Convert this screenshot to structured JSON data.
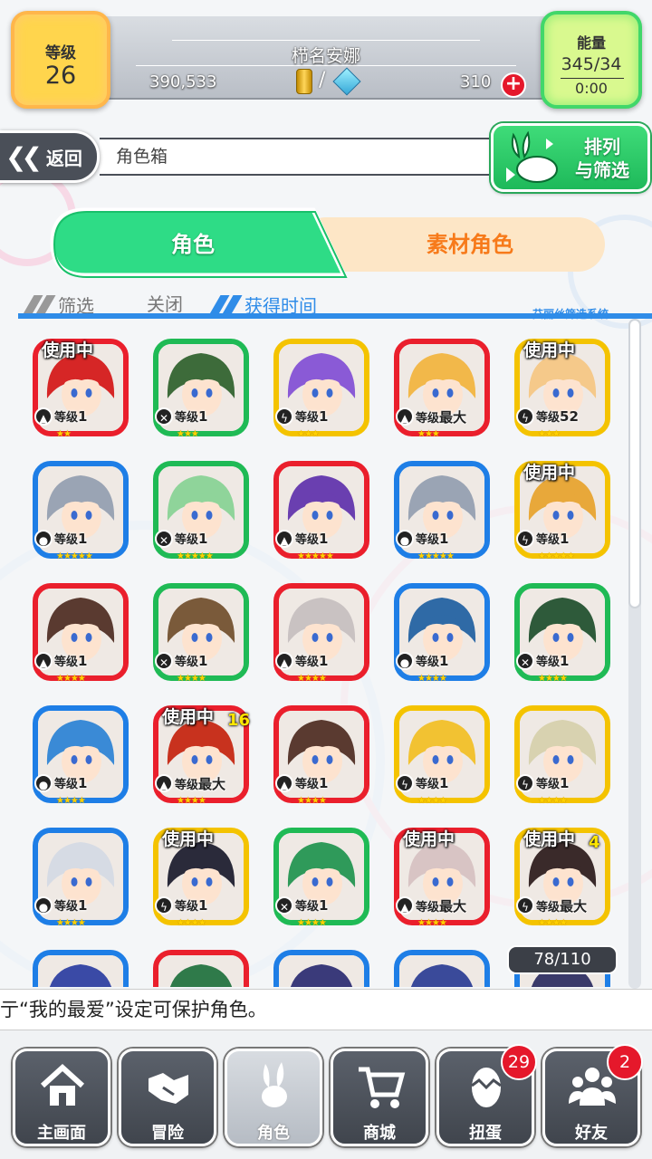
{
  "header": {
    "level_label": "等级",
    "level_value": "26",
    "player_name": "栉名安娜",
    "coins": "390,533",
    "slash": "/",
    "gems": "310",
    "energy_label": "能量",
    "energy_value": "345/34",
    "energy_timer": "0:00"
  },
  "nav": {
    "back_label": "返回",
    "breadcrumb": "角色箱",
    "sort_filter_line1": "排列",
    "sort_filter_line2": "与筛选"
  },
  "tabs": [
    {
      "label": "角色",
      "active": true
    },
    {
      "label": "素材角色",
      "active": false
    }
  ],
  "filter": {
    "filter_label": "筛选",
    "filter_state": "关闭",
    "sort_label": "获得时间",
    "system_label": "艾丽丝筛选系统"
  },
  "cards": [
    {
      "frame": "red",
      "element": "fire",
      "level": "1",
      "stars": 2,
      "in_use": "使用中",
      "badge": "",
      "hue": "#d62626"
    },
    {
      "frame": "green",
      "element": "wind",
      "level": "1",
      "stars": 3,
      "in_use": "",
      "badge": "",
      "hue": "#3d6b3a"
    },
    {
      "frame": "yellow",
      "element": "thunder",
      "level": "1",
      "stars": 3,
      "in_use": "",
      "badge": "",
      "hue": "#8a5ad6"
    },
    {
      "frame": "red",
      "element": "fire",
      "level": "最大",
      "stars": 3,
      "in_use": "",
      "badge": "",
      "hue": "#f2b84a"
    },
    {
      "frame": "yellow",
      "element": "thunder",
      "level": "52",
      "stars": 3,
      "in_use": "使用中",
      "badge": "",
      "hue": "#f5c98a"
    },
    {
      "frame": "blue",
      "element": "water",
      "level": "1",
      "stars": 5,
      "in_use": "",
      "badge": "",
      "hue": "#9aa4b4"
    },
    {
      "frame": "green",
      "element": "wind",
      "level": "1",
      "stars": 5,
      "in_use": "",
      "badge": "",
      "hue": "#8fd49a"
    },
    {
      "frame": "red",
      "element": "fire",
      "level": "1",
      "stars": 5,
      "in_use": "",
      "badge": "",
      "hue": "#6a3fb0"
    },
    {
      "frame": "blue",
      "element": "water",
      "level": "1",
      "stars": 5,
      "in_use": "",
      "badge": "",
      "hue": "#9aa4b4"
    },
    {
      "frame": "yellow",
      "element": "thunder",
      "level": "1",
      "stars": 5,
      "in_use": "使用中",
      "badge": "",
      "hue": "#e8a83a"
    },
    {
      "frame": "red",
      "element": "fire",
      "level": "1",
      "stars": 4,
      "in_use": "",
      "badge": "",
      "hue": "#5a3a30"
    },
    {
      "frame": "green",
      "element": "wind",
      "level": "1",
      "stars": 4,
      "in_use": "",
      "badge": "",
      "hue": "#7a5a3a"
    },
    {
      "frame": "red",
      "element": "fire",
      "level": "1",
      "stars": 4,
      "in_use": "",
      "badge": "",
      "hue": "#c9c2c2"
    },
    {
      "frame": "blue",
      "element": "water",
      "level": "1",
      "stars": 4,
      "in_use": "",
      "badge": "",
      "hue": "#2f6aa6"
    },
    {
      "frame": "green",
      "element": "wind",
      "level": "1",
      "stars": 4,
      "in_use": "",
      "badge": "",
      "hue": "#2e5a3a"
    },
    {
      "frame": "blue",
      "element": "water",
      "level": "1",
      "stars": 4,
      "in_use": "",
      "badge": "",
      "hue": "#3a8ad6"
    },
    {
      "frame": "red",
      "element": "fire",
      "level": "最大",
      "stars": 4,
      "in_use": "使用中",
      "badge": "16",
      "hue": "#c8321e"
    },
    {
      "frame": "red",
      "element": "fire",
      "level": "1",
      "stars": 4,
      "in_use": "",
      "badge": "",
      "hue": "#5a3a30"
    },
    {
      "frame": "yellow",
      "element": "thunder",
      "level": "1",
      "stars": 4,
      "in_use": "",
      "badge": "",
      "hue": "#f2c232"
    },
    {
      "frame": "yellow",
      "element": "thunder",
      "level": "1",
      "stars": 4,
      "in_use": "",
      "badge": "",
      "hue": "#d8d2b0"
    },
    {
      "frame": "blue",
      "element": "water",
      "level": "1",
      "stars": 4,
      "in_use": "",
      "badge": "",
      "hue": "#d6dbe4"
    },
    {
      "frame": "yellow",
      "element": "thunder",
      "level": "1",
      "stars": 4,
      "in_use": "使用中",
      "badge": "",
      "hue": "#2a2a3a"
    },
    {
      "frame": "green",
      "element": "wind",
      "level": "1",
      "stars": 4,
      "in_use": "",
      "badge": "",
      "hue": "#2f9a5a"
    },
    {
      "frame": "red",
      "element": "fire",
      "level": "最大",
      "stars": 4,
      "in_use": "使用中",
      "badge": "",
      "hue": "#d8c4c4"
    },
    {
      "frame": "yellow",
      "element": "thunder",
      "level": "最大",
      "stars": 4,
      "in_use": "使用中",
      "badge": "4",
      "hue": "#3a2a2a"
    },
    {
      "frame": "blue",
      "element": "water",
      "level": "",
      "stars": 0,
      "in_use": "",
      "badge": "",
      "hue": "#3a4aa6"
    },
    {
      "frame": "red",
      "element": "fire",
      "level": "",
      "stars": 0,
      "in_use": "",
      "badge": "",
      "hue": "#2f7a4a"
    },
    {
      "frame": "blue",
      "element": "water",
      "level": "",
      "stars": 0,
      "in_use": "",
      "badge": "",
      "hue": "#3a3a7a"
    },
    {
      "frame": "blue",
      "element": "water",
      "level": "",
      "stars": 0,
      "in_use": "",
      "badge": "",
      "hue": "#3a4a9a"
    },
    {
      "frame": "blue",
      "element": "water",
      "level": "",
      "stars": 0,
      "in_use": "",
      "badge": "",
      "hue": "#3a3a6a"
    }
  ],
  "level_prefix": "等级",
  "card_count": "78/110",
  "tip": "亍“我的最爱”设定可保护角色。",
  "bottom_nav": [
    {
      "label": "主画面",
      "icon": "home-icon",
      "badge": ""
    },
    {
      "label": "冒险",
      "icon": "handshake-icon",
      "badge": ""
    },
    {
      "label": "角色",
      "icon": "rabbit-icon",
      "badge": "",
      "active": true
    },
    {
      "label": "商城",
      "icon": "cart-icon",
      "badge": ""
    },
    {
      "label": "扭蛋",
      "icon": "egg-icon",
      "badge": "29"
    },
    {
      "label": "好友",
      "icon": "friends-icon",
      "badge": "2"
    }
  ],
  "colors": {
    "accent_green": "#1fba55",
    "accent_orange": "#f77a1a",
    "accent_blue": "#2f8ce8",
    "badge_red": "#e5182b"
  }
}
